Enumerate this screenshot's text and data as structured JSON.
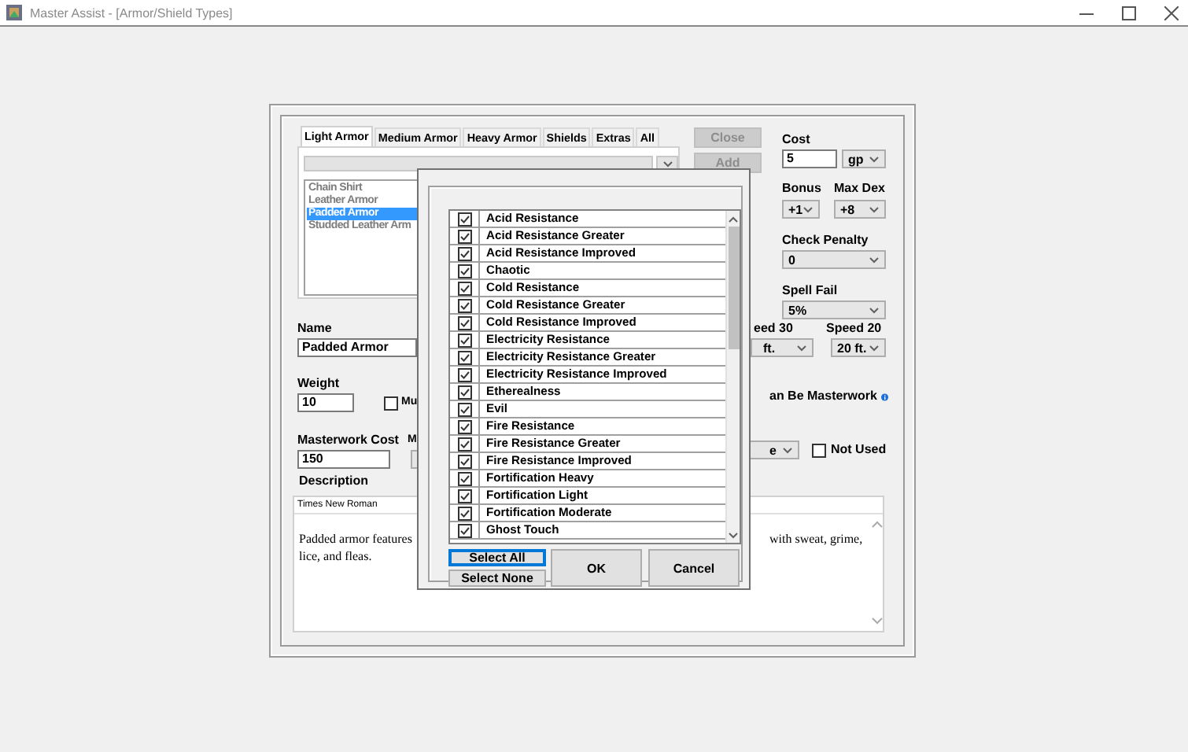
{
  "window": {
    "title": "Master Assist - [Armor/Shield Types]"
  },
  "tabs": [
    {
      "label": "Light Armor",
      "selected": true
    },
    {
      "label": "Medium Armor",
      "selected": false
    },
    {
      "label": "Heavy Armor",
      "selected": false
    },
    {
      "label": "Shields",
      "selected": false
    },
    {
      "label": "Extras",
      "selected": false
    },
    {
      "label": "All",
      "selected": false
    }
  ],
  "side_buttons": [
    {
      "label": "Close",
      "disabled": true
    },
    {
      "label": "Add",
      "disabled": true
    }
  ],
  "armor_list": [
    {
      "label": "Chain Shirt",
      "selected": false
    },
    {
      "label": "Leather Armor",
      "selected": false
    },
    {
      "label": "Padded Armor",
      "selected": true
    },
    {
      "label": "Studded Leather Arm",
      "selected": false
    }
  ],
  "cost": {
    "label": "Cost",
    "value": "5",
    "unit": "gp"
  },
  "bonus": {
    "label": "Bonus",
    "value": "+1"
  },
  "max_dex": {
    "label": "Max Dex",
    "value": "+8"
  },
  "check_penalty": {
    "label": "Check Penalty",
    "value": "0"
  },
  "spell_fail": {
    "label": "Spell Fail",
    "value": "5%"
  },
  "speed_30": {
    "label": "eed 30",
    "value": "ft."
  },
  "speed_20": {
    "label": "Speed 20",
    "value": "20 ft."
  },
  "name": {
    "label": "Name",
    "value": "Padded Armor"
  },
  "weight": {
    "label": "Weight",
    "value": "10"
  },
  "weight_checkbox": {
    "label": "Mu",
    "checked": false
  },
  "masterwork_cost": {
    "label": "Masterwork Cost",
    "value": "150"
  },
  "label_m": "M",
  "can_be_masterwork": {
    "label": "an Be Masterwork"
  },
  "dropdown_3": {
    "value": "e"
  },
  "not_used": {
    "label": "Not Used",
    "checked": false
  },
  "description": {
    "label": "Description",
    "font": "Times New Roman",
    "lines": [
      [
        "Padded armor features",
        "with sweat, grime,"
      ],
      [
        "lice, and fleas."
      ]
    ]
  },
  "dialog": {
    "items": [
      {
        "label": "Acid Resistance",
        "checked": true
      },
      {
        "label": "Acid Resistance Greater",
        "checked": true
      },
      {
        "label": "Acid Resistance Improved",
        "checked": true
      },
      {
        "label": "Chaotic",
        "checked": true
      },
      {
        "label": "Cold Resistance",
        "checked": true
      },
      {
        "label": "Cold Resistance Greater",
        "checked": true
      },
      {
        "label": "Cold Resistance Improved",
        "checked": true
      },
      {
        "label": "Electricity Resistance",
        "checked": true
      },
      {
        "label": "Electricity Resistance Greater",
        "checked": true
      },
      {
        "label": "Electricity Resistance Improved",
        "checked": true
      },
      {
        "label": "Etherealness",
        "checked": true
      },
      {
        "label": "Evil",
        "checked": true
      },
      {
        "label": "Fire Resistance",
        "checked": true
      },
      {
        "label": "Fire Resistance Greater",
        "checked": true
      },
      {
        "label": "Fire Resistance Improved",
        "checked": true
      },
      {
        "label": "Fortification Heavy",
        "checked": true
      },
      {
        "label": "Fortification Light",
        "checked": true
      },
      {
        "label": "Fortification Moderate",
        "checked": true
      },
      {
        "label": "Ghost Touch",
        "checked": true
      }
    ],
    "buttons": [
      {
        "label": "Select All",
        "kind": "select-all"
      },
      {
        "label": "Select None",
        "kind": "select-none"
      },
      {
        "label": "OK",
        "kind": "ok"
      },
      {
        "label": "Cancel",
        "kind": "cancel"
      }
    ]
  }
}
